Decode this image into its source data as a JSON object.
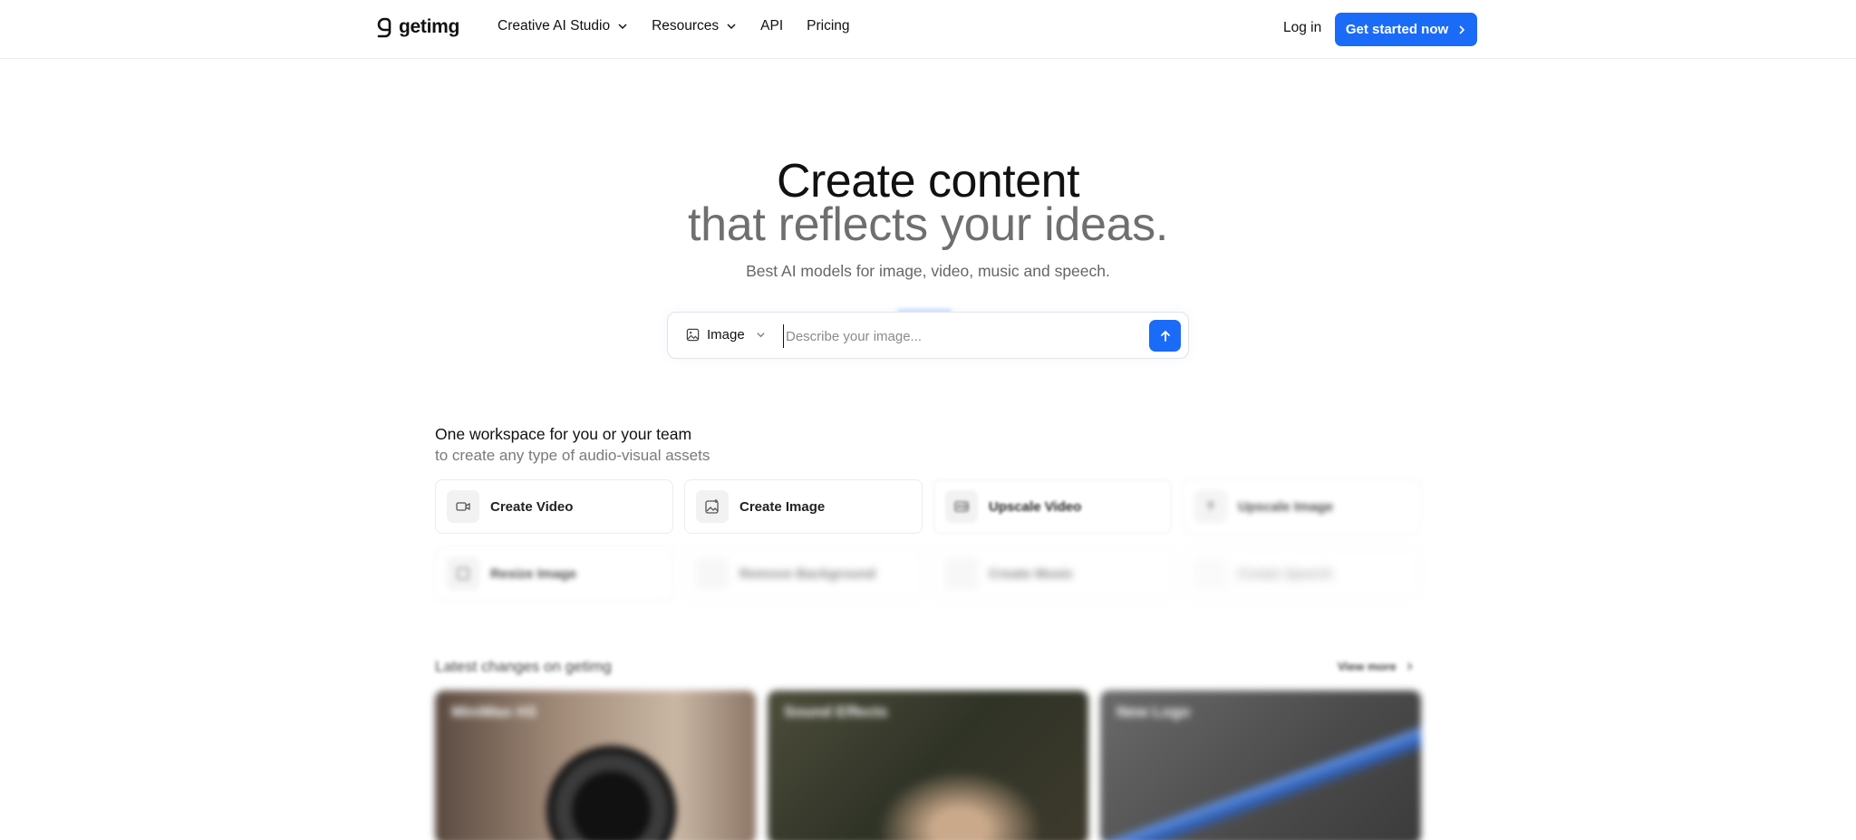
{
  "nav": {
    "logo_text": "getimg",
    "links": [
      {
        "label": "Creative AI Studio",
        "has_dropdown": true
      },
      {
        "label": "Resources",
        "has_dropdown": true
      },
      {
        "label": "API",
        "has_dropdown": false
      },
      {
        "label": "Pricing",
        "has_dropdown": false
      }
    ],
    "login_label": "Log in",
    "cta_label": "Get started now"
  },
  "hero": {
    "title_line1": "Create content",
    "title_line2": "that reflects your ideas.",
    "subtitle": "Best AI models for image, video, music and speech."
  },
  "prompt": {
    "type_label": "Image",
    "placeholder": "Describe your image..."
  },
  "workspace": {
    "title": "One workspace for you or your team",
    "subtitle": "to create any type of audio-visual assets",
    "tiles": [
      {
        "label": "Create Video",
        "icon": "video-icon"
      },
      {
        "label": "Create Image",
        "icon": "image-plus-icon"
      },
      {
        "label": "Upscale Video",
        "icon": "hd-icon"
      },
      {
        "label": "Upscale Image",
        "icon": "arrow-up-icon"
      },
      {
        "label": "Resize Image",
        "icon": "resize-icon"
      },
      {
        "label": "Remove Background",
        "icon": "remove-bg-icon"
      },
      {
        "label": "Create Music",
        "icon": "music-icon"
      },
      {
        "label": "Create Speech",
        "icon": "speech-icon"
      }
    ]
  },
  "latest": {
    "title": "Latest changes on getimg",
    "view_more": "View more",
    "cards": [
      {
        "title": "MiniMax H3"
      },
      {
        "title": "Sound Effects"
      },
      {
        "title": "New Logo"
      }
    ]
  },
  "colors": {
    "accent": "#1a6bf7",
    "text": "#111111",
    "muted": "#6f6f6f"
  }
}
